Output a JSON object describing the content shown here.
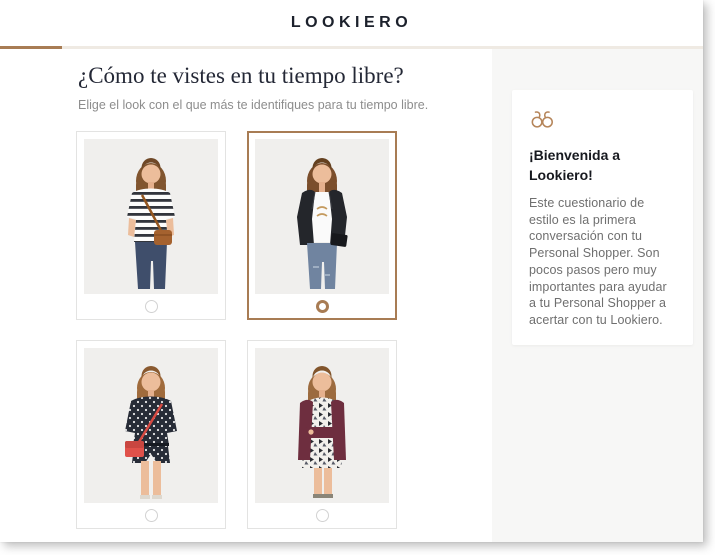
{
  "header": {
    "logo": "LOOKIERO"
  },
  "progress": {
    "percent": 8.8,
    "fill_color": "#a87c54",
    "track_color": "#efeae3"
  },
  "question": {
    "title": "¿Cómo te vistes en tu tiempo libre?",
    "subtitle": "Elige el look con el que más te identifiques para tu tiempo libre."
  },
  "options": [
    {
      "name": "striped-tee-jeans-brown-bag",
      "selected": false
    },
    {
      "name": "black-leather-jacket-white-tee-jeans",
      "selected": true
    },
    {
      "name": "polka-dot-romper-red-bag",
      "selected": false
    },
    {
      "name": "burgundy-cardigan-print-dress",
      "selected": false
    }
  ],
  "sidebar": {
    "icon": "glasses-icon",
    "title": "¡Bienvenida a Lookiero!",
    "body": "Este cuestionario de estilo es la primera conversación con tu Personal Shopper. Son pocos pasos pero muy importantes para ayudar a tu Personal Shopper a acertar con tu Lookiero.",
    "accent_color": "#a87c54"
  }
}
